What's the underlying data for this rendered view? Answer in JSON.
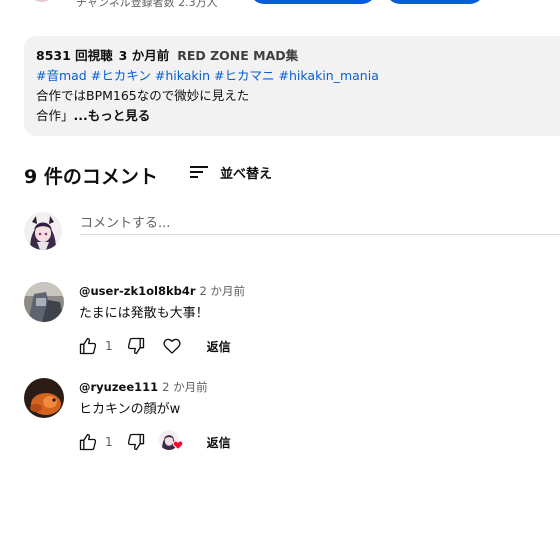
{
  "header": {
    "subscriber_text": "チャンネル登録者数 2.3万人"
  },
  "description": {
    "views": "8531 回視聴",
    "age": "3 か月前",
    "playlist": "RED ZONE MAD集",
    "hashtags": [
      "#音mad",
      "#ヒカキン",
      "#hikakin",
      "#ヒカマニ",
      "#hikakin_mania"
    ],
    "line1": "合作ではBPM165なので微妙に見えた",
    "line2_prefix": "合作」",
    "more_label": "...もっと見る"
  },
  "comments_section": {
    "count_title": "9 件のコメント",
    "sort_label": "並べ替え",
    "add_comment_placeholder": "コメントする..."
  },
  "comments": [
    {
      "author": "@user-zk1ol8kb4r",
      "time": "2 か月前",
      "text": "たまには発散も大事！",
      "likes": "1",
      "reply_label": "返信",
      "hearted_by_creator": false
    },
    {
      "author": "@ryuzee111",
      "time": "2 か月前",
      "text": "ヒカキンの顔がw",
      "likes": "1",
      "reply_label": "返信",
      "hearted_by_creator": true
    }
  ],
  "colors": {
    "link_blue": "#065fd4",
    "heart_red": "#ff0033",
    "desc_bg": "#f2f2f2"
  },
  "icons": [
    "thumbs-up-icon",
    "thumbs-down-icon",
    "heart-icon",
    "sort-icon",
    "creator-heart-badge-icon"
  ]
}
